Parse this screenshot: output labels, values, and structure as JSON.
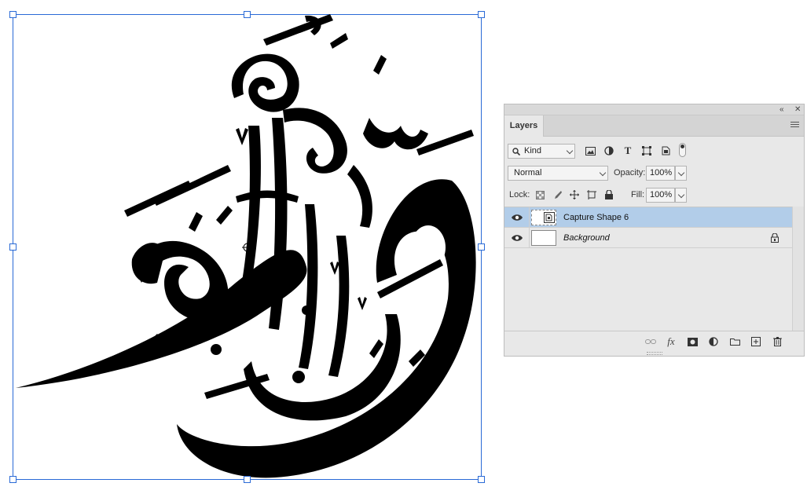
{
  "panel": {
    "tab_label": "Layers",
    "collapse_icon": "double-chevron-left-icon",
    "close_icon": "close-icon",
    "filter": {
      "kind_label": "Kind",
      "icons": [
        "image-filter-icon",
        "adjustment-filter-icon",
        "type-filter-icon",
        "shape-filter-icon",
        "smart-object-filter-icon"
      ]
    },
    "blend_mode": "Normal",
    "opacity_label": "Opacity:",
    "opacity_value": "100%",
    "lock_label": "Lock:",
    "fill_label": "Fill:",
    "fill_value": "100%",
    "layers": [
      {
        "name": "Capture Shape 6",
        "selected": true,
        "visible": true
      },
      {
        "name": "Background",
        "selected": false,
        "visible": true,
        "locked": true
      }
    ],
    "bottom_icons": [
      "link-layers-icon",
      "fx-icon",
      "layer-mask-icon",
      "adjustment-layer-icon",
      "group-folder-icon",
      "new-layer-icon",
      "trash-icon"
    ],
    "fx_label": "fx"
  },
  "colors": {
    "selection": "#b2cde9",
    "transform_box": "#2a6ad6",
    "artwork": "#000000"
  }
}
